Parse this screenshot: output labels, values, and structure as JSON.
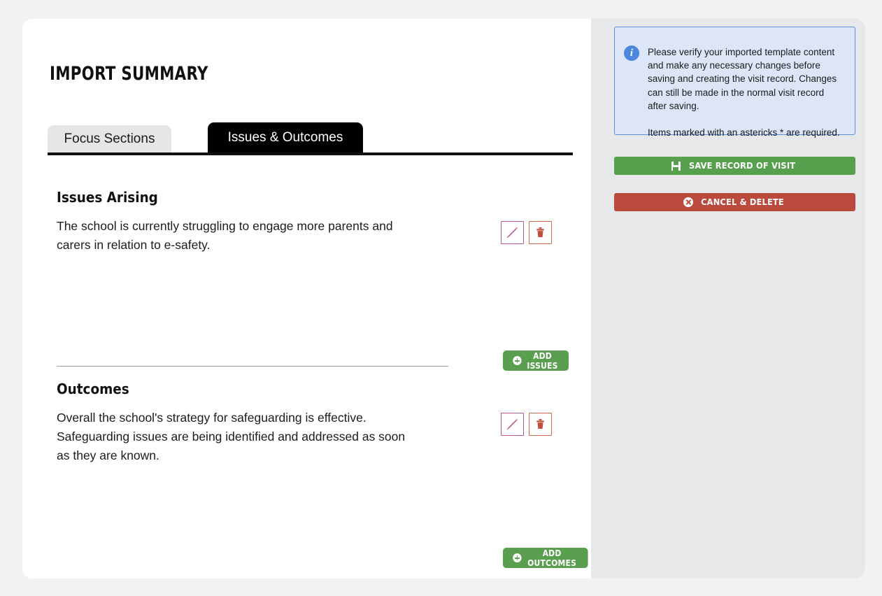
{
  "page": {
    "title": "IMPORT SUMMARY"
  },
  "tabs": [
    {
      "label": "Focus Sections",
      "active": false
    },
    {
      "label": "Issues & Outcomes",
      "active": true
    }
  ],
  "sections": [
    {
      "heading": "Issues Arising",
      "text": "The school is currently struggling to engage more parents and carers in relation to e-safety.",
      "edit_icon": "pencil-icon",
      "delete_icon": "trash-icon",
      "add_button_label": "ADD ISSUES"
    },
    {
      "heading": "Outcomes",
      "text": "Overall the school's strategy for safeguarding is effective. Safeguarding issues are being identified and addressed as soon as they are known.",
      "edit_icon": "pencil-icon",
      "delete_icon": "trash-icon",
      "add_button_label": "ADD OUTCOMES"
    }
  ],
  "sidebar": {
    "info": {
      "icon": "info-icon",
      "icon_glyph": "i",
      "text": "Please verify your imported template content and make any necessary changes before saving and creating the visit record. Changes can still be made in the normal visit record after saving.\n\nItems marked with an astericks * are required."
    },
    "save_button": {
      "label": "SAVE RECORD OF VISIT",
      "icon": "floppy-disk-icon"
    },
    "cancel_button": {
      "label": "CANCEL & DELETE",
      "icon": "x-circle-icon"
    }
  },
  "colors": {
    "page_background": "#f2f2f2",
    "card_background": "#ffffff",
    "sidebar_background": "#e7e8ea",
    "active_tab": "#000000",
    "inactive_tab": "#e6e6e6",
    "info_box_background": "#dce6f8",
    "info_box_border": "#5b8fde",
    "info_icon": "#4d86dd",
    "save_green": "#57a04e",
    "add_green": "#5a9e50",
    "cancel_red": "#bc4a3c",
    "edit_icon": "#b9558c",
    "delete_icon": "#cf6a4a"
  }
}
